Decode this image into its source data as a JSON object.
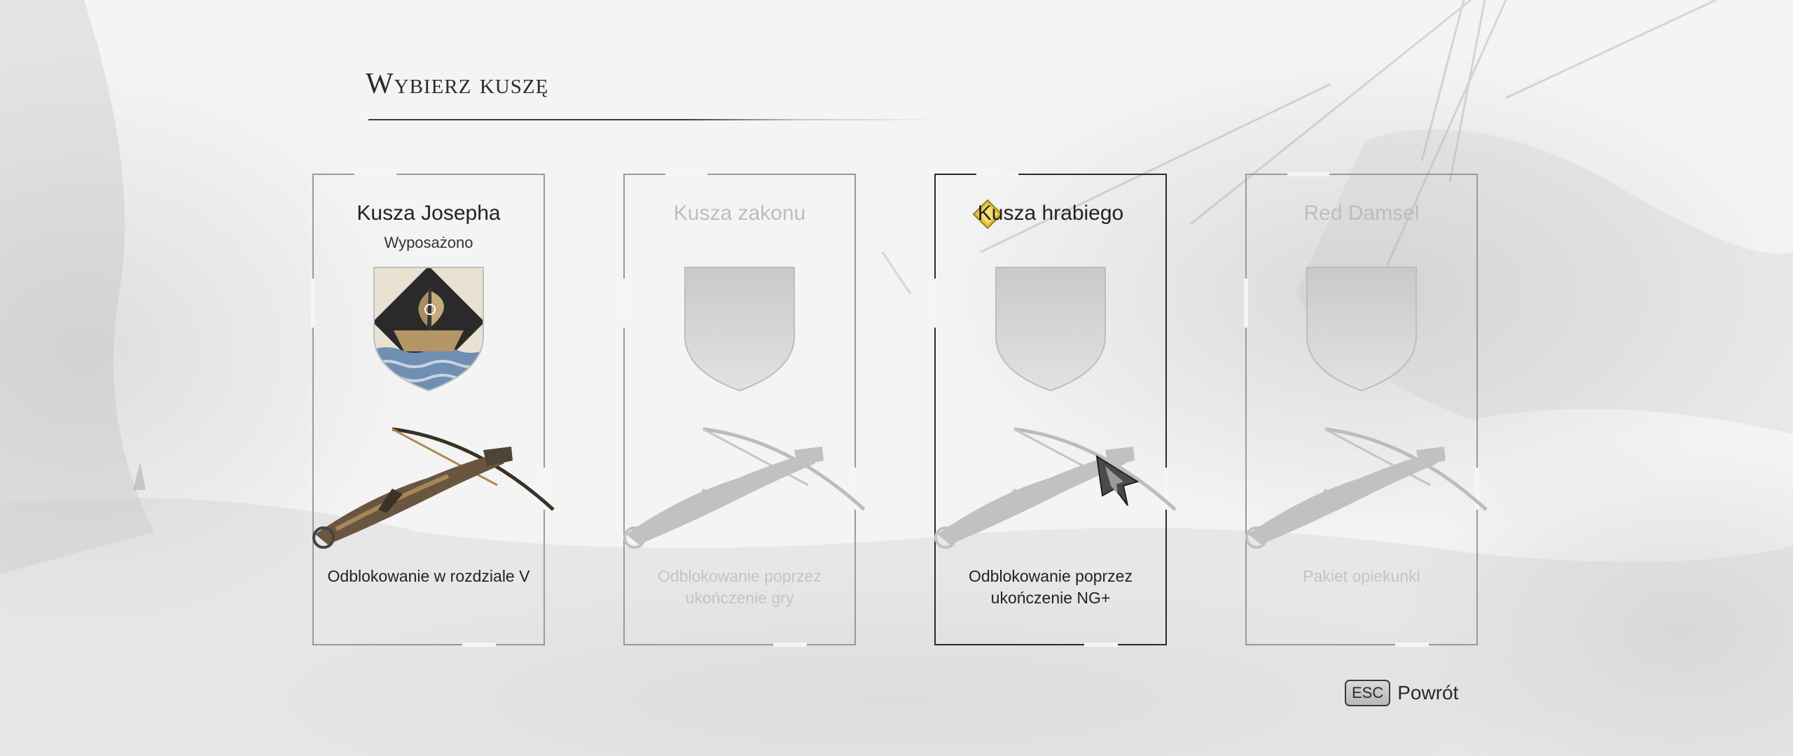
{
  "screen": {
    "title": "Wybierz kuszę"
  },
  "crossbows": [
    {
      "name": "Kusza Josepha",
      "status": "Wyposażono",
      "description": "Odblokowanie w rozdziale V",
      "state": "equipped",
      "emblem": "ship-crest-icon"
    },
    {
      "name": "Kusza zakonu",
      "status": "",
      "description": "Odblokowanie poprzez ukończenie gry",
      "state": "locked",
      "emblem": "blank-shield-icon"
    },
    {
      "name": "Kusza hrabiego",
      "status": "",
      "description": "Odblokowanie poprzez ukończenie NG+",
      "state": "selected",
      "emblem": "blank-shield-icon"
    },
    {
      "name": "Red Damsel",
      "status": "",
      "description": "Pakiet opiekunki",
      "state": "locked",
      "emblem": "blank-shield-icon"
    }
  ],
  "footer": {
    "key": "ESC",
    "label": "Powrót"
  },
  "colors": {
    "background": "#f4f4f4",
    "text": "#222222",
    "locked_text": "#c4c4c4",
    "gem": "#e3c23a"
  }
}
